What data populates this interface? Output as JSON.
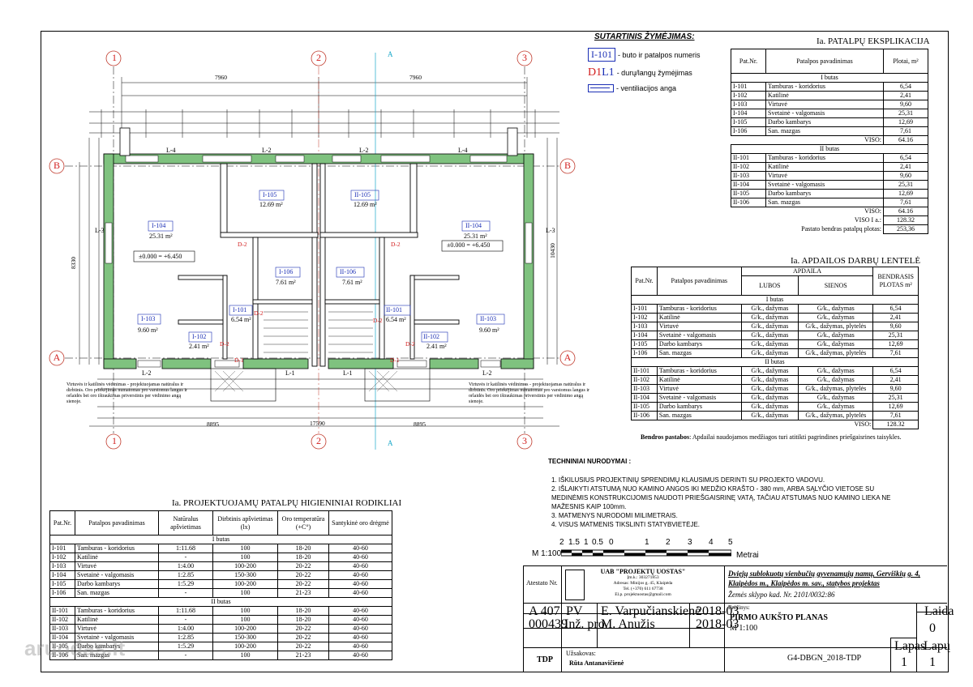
{
  "legend": {
    "title": "SUTARTINIS ŽYMĖJIMAS:",
    "item1_code": "I-101",
    "item1_text": "- buto ir patalpos numeris",
    "item2_d": "D1",
    "item2_l": "L1",
    "item2_text": "- durų/langų žymėjimas",
    "item3_text": "- ventiliacijos anga"
  },
  "plan": {
    "axes_top": [
      "1",
      "2",
      "3"
    ],
    "axes_bottom": [
      "1",
      "2",
      "3"
    ],
    "axes_side": [
      "A",
      "B"
    ],
    "section_mark": "A",
    "dim_top": [
      "7960",
      "7960"
    ],
    "dim_bottom_total": "17590",
    "dim_bottom": [
      "8895",
      "8895"
    ],
    "dim_left": "8330",
    "dim_right": "10430",
    "rooms": [
      {
        "code": "I-104",
        "area": "25.31 m²"
      },
      {
        "code": "I-105",
        "area": "12.69 m²"
      },
      {
        "code": "I-106",
        "area": "7.61 m²"
      },
      {
        "code": "I-103",
        "area": "9.60 m²"
      },
      {
        "code": "I-101",
        "area": "6.54 m²"
      },
      {
        "code": "I-102",
        "area": "2.41 m²"
      },
      {
        "code": "II-104",
        "area": "25.31 m²"
      },
      {
        "code": "II-105",
        "area": "12.69 m²"
      },
      {
        "code": "II-106",
        "area": "7.61 m²"
      },
      {
        "code": "II-103",
        "area": "9.60 m²"
      },
      {
        "code": "II-101",
        "area": "6.54 m²"
      },
      {
        "code": "II-102",
        "area": "2.41 m²"
      }
    ],
    "level_mark": "±0.000 = +6.450",
    "doors": [
      "D-2",
      "D-2",
      "D-2",
      "D-1",
      "D-1",
      "D-2",
      "D-2",
      "D-2"
    ],
    "windows": [
      "L-4",
      "L-2",
      "L-2",
      "L-4",
      "L-2",
      "L-1",
      "L-1",
      "L-2",
      "L-3",
      "L-3"
    ],
    "note_left": "Virtuvės ir katilinės vėdinimas - projektuojamas natūralus ir dirbtinis. Oro priekėjimas numatomas pro varstomus langus ir orlaidės bei oro ištraukimas priverstinis per vėdinimo angą sienoje.",
    "note_right": "Virtuvės ir katilinės vėdinimas - projektuojamas natūralus ir dirbtinis. Oro priekėjimas numatomas pro varstomus langus ir orlaidės bei oro ištraukimas priverstinis per vėdinimo angą sienoje."
  },
  "explication": {
    "title": "Ia. PATALPŲ EKSPLIKACIJA",
    "headers": [
      "Pat.Nr.",
      "Patalpos pavadinimas",
      "Plotai, m²"
    ],
    "section1": "I butas",
    "rows1": [
      [
        "I-101",
        "Tamburas - koridorius",
        "6,54"
      ],
      [
        "I-102",
        "Katilinė",
        "2,41"
      ],
      [
        "I-103",
        "Virtuvė",
        "9,60"
      ],
      [
        "I-104",
        "Svetainė - valgomasis",
        "25,31"
      ],
      [
        "I-105",
        "Darbo kambarys",
        "12,69"
      ],
      [
        "I-106",
        "San. mazgas",
        "7,61"
      ]
    ],
    "viso1_label": "VISO:",
    "viso1": "64.16",
    "section2": "II butas",
    "rows2": [
      [
        "II-101",
        "Tamburas - koridorius",
        "6,54"
      ],
      [
        "II-102",
        "Katilinė",
        "2,41"
      ],
      [
        "II-103",
        "Virtuvė",
        "9,60"
      ],
      [
        "II-104",
        "Svetainė - valgomasis",
        "25,31"
      ],
      [
        "II-105",
        "Darbo kambarys",
        "12,69"
      ],
      [
        "II-106",
        "San. mazgas",
        "7,61"
      ]
    ],
    "viso2_label": "VISO:",
    "viso2": "64.16",
    "viso_ia_label": "VISO I a.:",
    "viso_ia": "128.32",
    "total_label": "Pastato bendras patalpų plotas:",
    "total": "253,36"
  },
  "finishing": {
    "title": "Ia. APDAILOS DARBŲ LENTELĖ",
    "h_nr": "Pat.Nr.",
    "h_name": "Patalpos pavadinimas",
    "h_apdaila": "APDAILA",
    "h_lubos": "LUBOS",
    "h_sienos": "SIENOS",
    "h_plotas": "BENDRASIS PLOTAS m²",
    "section1": "I butas",
    "rows1": [
      [
        "I-101",
        "Tamburas - koridorius",
        "G/k., dažymas",
        "G/k., dažymas",
        "6,54"
      ],
      [
        "I-102",
        "Katilinė",
        "G/k., dažymas",
        "G/k., dažymas",
        "2,41"
      ],
      [
        "I-103",
        "Virtuvė",
        "G/k., dažymas",
        "G/k., dažymas, plytelės",
        "9,60"
      ],
      [
        "I-104",
        "Svetainė - valgomasis",
        "G/k., dažymas",
        "G/k., dažymas",
        "25,31"
      ],
      [
        "I-105",
        "Darbo kambarys",
        "G/k., dažymas",
        "G/k., dažymas",
        "12,69"
      ],
      [
        "I-106",
        "San. mazgas",
        "G/k., dažymas",
        "G/k., dažymas, plytelės",
        "7,61"
      ]
    ],
    "section2": "II butas",
    "rows2": [
      [
        "II-101",
        "Tamburas - koridorius",
        "G/k., dažymas",
        "G/k., dažymas",
        "6,54"
      ],
      [
        "II-102",
        "Katilinė",
        "G/k., dažymas",
        "G/k., dažymas",
        "2,41"
      ],
      [
        "II-103",
        "Virtuvė",
        "G/k., dažymas",
        "G/k., dažymas, plytelės",
        "9,60"
      ],
      [
        "II-104",
        "Svetainė - valgomasis",
        "G/k., dažymas",
        "G/k., dažymas",
        "25,31"
      ],
      [
        "II-105",
        "Darbo kambarys",
        "G/k., dažymas",
        "G/k., dažymas",
        "12,69"
      ],
      [
        "II-106",
        "San. mazgas",
        "G/k., dažymas",
        "G/k., dažymas, plytelės",
        "7,61"
      ]
    ],
    "viso_label": "VISO:",
    "viso": "128.32",
    "remark_label": "Bendros pastabos",
    "remark": ":  Apdailai naudojamos medžiagos turi atitikti pagrindines priešgaisrines taisykles."
  },
  "tech": {
    "title": "TECHNINIAI NURODYMAI :",
    "lines": [
      "1. IŠKILUSIUS PROJEKTINIŲ SPRENDIMŲ KLAUSIMUS DERINTI SU PROJEKTO VADOVU.",
      "2. IŠLAIKYTI ATSTUMĄ NUO KAMINO ANGOS IKI MEDŽIO KRAŠTO - 380 mm, ARBA SĄLYČIO VIETOSE SU",
      "MEDINĖMIS KONSTRUKCIJOMIS NAUDOTI PRIEŠGAISRINĘ VATĄ, TAČIAU ATSTUMAS NUO KAMINO LIEKA NE",
      "MAŽESNIS KAIP 100mm.",
      "3. MATMENYS NURODOMI MILIMETRAIS.",
      "4. VISUS MATMENIS TIKSLINTI STATYBVIETĖJE."
    ]
  },
  "scale": {
    "numbers": [
      "2",
      "1.5",
      "1",
      "0.5",
      "0",
      "1",
      "2",
      "3",
      "4",
      "5"
    ],
    "left": "M 1:100",
    "right": "Metrai"
  },
  "hygiene": {
    "title": "Ia. PROJEKTUOJAMŲ PATALPŲ HIGIENINIAI RODIKLIAI",
    "headers": [
      "Pat.Nr.",
      "Patalpos pavadinimas",
      "Natūralus apšvietimas",
      "Dirbtinis apšvietimas (lx)",
      "Oro temperatūra (+C°)",
      "Santykinė oro drėgmė"
    ],
    "section1": "I butas",
    "rows1": [
      [
        "I-101",
        "Tamburas - koridorius",
        "1:11.68",
        "100",
        "18-20",
        "40-60"
      ],
      [
        "I-102",
        "Katilinė",
        "-",
        "100",
        "18-20",
        "40-60"
      ],
      [
        "I-103",
        "Virtuvė",
        "1:4.00",
        "100-200",
        "20-22",
        "40-60"
      ],
      [
        "I-104",
        "Svetainė - valgomasis",
        "1:2.85",
        "150-300",
        "20-22",
        "40-60"
      ],
      [
        "I-105",
        "Darbo kambarys",
        "1:5.29",
        "100-200",
        "20-22",
        "40-60"
      ],
      [
        "I-106",
        "San. mazgas",
        "-",
        "100",
        "21-23",
        "40-60"
      ]
    ],
    "section2": "II butas",
    "rows2": [
      [
        "II-101",
        "Tamburas - koridorius",
        "1:11.68",
        "100",
        "18-20",
        "40-60"
      ],
      [
        "II-102",
        "Katilinė",
        "-",
        "100",
        "18-20",
        "40-60"
      ],
      [
        "II-103",
        "Virtuvė",
        "1:4.00",
        "100-200",
        "20-22",
        "40-60"
      ],
      [
        "II-104",
        "Svetainė - valgomasis",
        "1:2.85",
        "150-300",
        "20-22",
        "40-60"
      ],
      [
        "II-105",
        "Darbo kambarys",
        "1:5.29",
        "100-200",
        "20-22",
        "40-60"
      ],
      [
        "II-106",
        "San. mazgas",
        "-",
        "100",
        "21-23",
        "40-60"
      ]
    ]
  },
  "title_block": {
    "atestato_label": "Atestato Nr.",
    "company": "UAB \"PROJEKTŲ UOSTAS\"",
    "company_code": "Įm.k.: 303271853",
    "company_address": "Adresas: Minijos g. 45, Klaipėda",
    "company_tel": "Tel. (+370) 611 67738",
    "company_email": "El.p. projektuostas@gmail.com",
    "project_title": "Dvięjų sublokuotų vienbučių gyvenamųjų namų, Gerviškių g. 4, Klaipėdos m., Klaipėdos m. sav., statybos projektas",
    "plot": "Žemės sklypo kad. Nr. 2101/0032:86",
    "row1": [
      "A 407",
      "PV",
      "E. Varpučianskienė",
      "2018-03"
    ],
    "row2": [
      "000439",
      "Inž. pro.",
      "M. Anužis",
      "2018-03"
    ],
    "breziniys_label": "Brėžinys:",
    "drawing_title": "PIRMO AUKŠTO PLANAS",
    "drawing_scale": "M 1:100",
    "laida_label": "Laida",
    "laida": "0",
    "stage": "TDP",
    "uzsakovas_label": "Užsakovas:",
    "client": "Rūta Antanavičienė",
    "code": "G4-DBGN_2018-TDP",
    "lapas_label": "Lapas",
    "lapu_label": "Lapų",
    "lapas": "1",
    "lapu": "1"
  },
  "watermark": "aruodas.lt"
}
